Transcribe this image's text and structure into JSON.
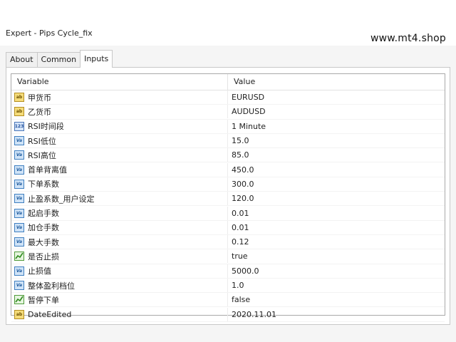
{
  "window": {
    "title": "Expert - Pips Cycle_fix"
  },
  "watermark": "www.mt4.shop",
  "tabs": [
    {
      "label": "About",
      "active": false
    },
    {
      "label": "Common",
      "active": false
    },
    {
      "label": "Inputs",
      "active": true
    }
  ],
  "table": {
    "headers": {
      "variable": "Variable",
      "value": "Value"
    },
    "rows": [
      {
        "icon": "string-icon",
        "variable": "甲货币",
        "value": "EURUSD"
      },
      {
        "icon": "string-icon",
        "variable": "乙货币",
        "value": "AUDUSD"
      },
      {
        "icon": "enum-icon",
        "variable": "RSI时间段",
        "value": "1 Minute"
      },
      {
        "icon": "double-icon",
        "variable": "RSI低位",
        "value": "15.0"
      },
      {
        "icon": "double-icon",
        "variable": "RSI高位",
        "value": "85.0"
      },
      {
        "icon": "double-icon",
        "variable": "首单背离值",
        "value": "450.0"
      },
      {
        "icon": "double-icon",
        "variable": "下单系数",
        "value": "300.0"
      },
      {
        "icon": "double-icon",
        "variable": "止盈系数_用户设定",
        "value": "120.0"
      },
      {
        "icon": "double-icon",
        "variable": "起启手数",
        "value": "0.01"
      },
      {
        "icon": "double-icon",
        "variable": "加仓手数",
        "value": "0.01"
      },
      {
        "icon": "double-icon",
        "variable": "最大手数",
        "value": "0.12"
      },
      {
        "icon": "bool-icon",
        "variable": "是否止损",
        "value": "true"
      },
      {
        "icon": "double-icon",
        "variable": "止损值",
        "value": "5000.0"
      },
      {
        "icon": "double-icon",
        "variable": "整体盈利档位",
        "value": "1.0"
      },
      {
        "icon": "bool-icon",
        "variable": "暂停下单",
        "value": "false"
      },
      {
        "icon": "string-icon",
        "variable": "DateEdited",
        "value": "2020.11.01"
      }
    ]
  }
}
